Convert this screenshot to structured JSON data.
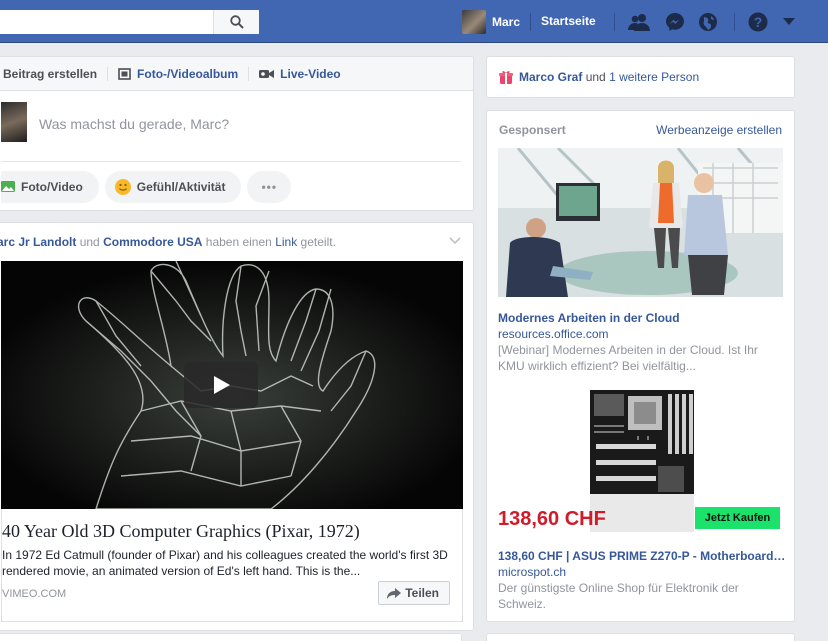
{
  "topbar": {
    "search_value": "",
    "user_name": "Marc",
    "home_label": "Startseite",
    "colors": {
      "bar": "#4267b2",
      "link": "#365899"
    }
  },
  "composer": {
    "tab_post": "Beitrag erstellen",
    "tab_album": "Foto-/Videoalbum",
    "tab_live": "Live-Video",
    "placeholder": "Was machst du gerade, Marc?",
    "btn_photo": "Foto/Video",
    "btn_feeling": "Gefühl/Aktivität",
    "btn_more": "•••"
  },
  "post": {
    "actor1": "arc Jr Landolt",
    "and1": "und",
    "actor2": "Commodore USA",
    "verb": "haben einen",
    "object": "Link",
    "suffix": "geteilt.",
    "link_title": "40 Year Old 3D Computer Graphics (Pixar, 1972)",
    "link_desc": "In 1972 Ed Catmull (founder of Pixar) and his colleagues created the world's first 3D rendered movie, an animated version of Ed's left hand. This is the...",
    "link_source": "VIMEO.COM",
    "share_label": "Teilen"
  },
  "birthday": {
    "name": "Marco Graf",
    "and": "und",
    "others": "1 weitere Person"
  },
  "ads": {
    "header": "Gesponsert",
    "create": "Werbeanzeige erstellen",
    "ad1": {
      "title": "Modernes Arbeiten in der Cloud",
      "domain": "resources.office.com",
      "desc": "[Webinar] Modernes Arbeiten in der Cloud. Ist Ihr KMU wirklich effizient? Bei vielfältig..."
    },
    "ad2": {
      "price": "138,60 CHF",
      "buy": "Jetzt Kaufen",
      "title": "138,60 CHF | ASUS PRIME Z270-P - Motherboard…",
      "domain": "microspot.ch",
      "desc": "Der günstigste Online Shop für Elektronik der Schweiz."
    }
  }
}
